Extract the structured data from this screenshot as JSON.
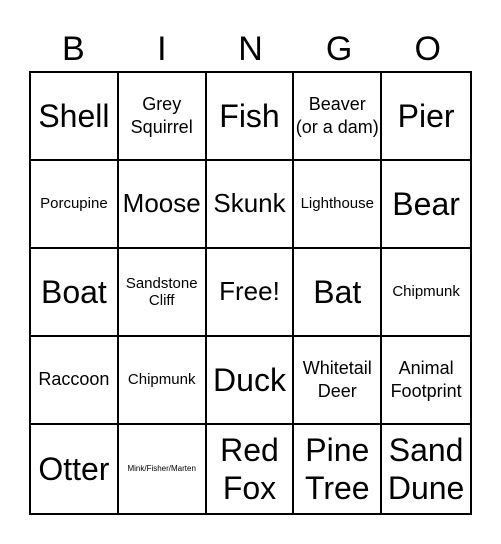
{
  "header": [
    "B",
    "I",
    "N",
    "G",
    "O"
  ],
  "cells": [
    {
      "text": "Shell",
      "size": "xl"
    },
    {
      "text": "Grey Squirrel",
      "size": "md"
    },
    {
      "text": "Fish",
      "size": "xl"
    },
    {
      "text": "Beaver (or a dam)",
      "size": "md"
    },
    {
      "text": "Pier",
      "size": "xl"
    },
    {
      "text": "Porcupine",
      "size": "sm"
    },
    {
      "text": "Moose",
      "size": "lg"
    },
    {
      "text": "Skunk",
      "size": "lg"
    },
    {
      "text": "Lighthouse",
      "size": "sm"
    },
    {
      "text": "Bear",
      "size": "xl"
    },
    {
      "text": "Boat",
      "size": "xl"
    },
    {
      "text": "Sandstone Cliff",
      "size": "sm"
    },
    {
      "text": "Free!",
      "size": "lg"
    },
    {
      "text": "Bat",
      "size": "xl"
    },
    {
      "text": "Chipmunk",
      "size": "sm"
    },
    {
      "text": "Raccoon",
      "size": "md"
    },
    {
      "text": "Chipmunk",
      "size": "sm"
    },
    {
      "text": "Duck",
      "size": "xl"
    },
    {
      "text": "Whitetail Deer",
      "size": "md"
    },
    {
      "text": "Animal Footprint",
      "size": "md"
    },
    {
      "text": "Otter",
      "size": "xl"
    },
    {
      "text": "Mink/Fisher/Marten",
      "size": "xxs"
    },
    {
      "text": "Red Fox",
      "size": "xl"
    },
    {
      "text": "Pine Tree",
      "size": "xl"
    },
    {
      "text": "Sand Dune",
      "size": "xl"
    }
  ]
}
